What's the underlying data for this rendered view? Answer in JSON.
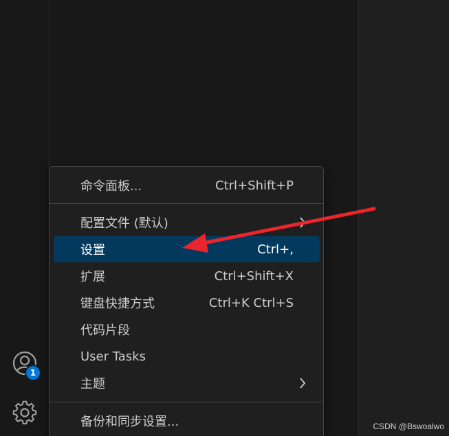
{
  "menu": {
    "items": [
      {
        "label": "命令面板...",
        "shortcut": "Ctrl+Shift+P",
        "submenu": false
      },
      {
        "label": "配置文件 (默认)",
        "shortcut": "",
        "submenu": true
      },
      {
        "label": "设置",
        "shortcut": "Ctrl+,",
        "submenu": false,
        "highlighted": true
      },
      {
        "label": "扩展",
        "shortcut": "Ctrl+Shift+X",
        "submenu": false
      },
      {
        "label": "键盘快捷方式",
        "shortcut": "Ctrl+K Ctrl+S",
        "submenu": false
      },
      {
        "label": "代码片段",
        "shortcut": "",
        "submenu": false
      },
      {
        "label": "User Tasks",
        "shortcut": "",
        "submenu": false
      },
      {
        "label": "主题",
        "shortcut": "",
        "submenu": true
      },
      {
        "label": "备份和同步设置...",
        "shortcut": "",
        "submenu": false
      }
    ]
  },
  "activity_bar": {
    "account_icon": "account-icon",
    "manage_icon": "gear-icon",
    "badge_count": "1"
  },
  "annotation": {
    "arrow_color": "#e8262b"
  },
  "watermark": "CSDN @Bswoalwo",
  "colors": {
    "highlight": "#04395e",
    "badge": "#0078d4",
    "menu_bg": "#1f1f1f"
  }
}
